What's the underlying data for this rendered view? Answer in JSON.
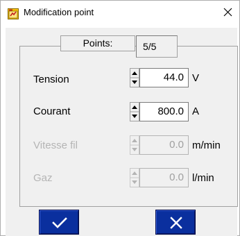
{
  "window": {
    "title": "Modification point",
    "close_glyph": "×"
  },
  "points": {
    "label": "Points:",
    "value": "5/5"
  },
  "params": [
    {
      "label": "Tension",
      "value": "44.0",
      "unit": "V",
      "enabled": true
    },
    {
      "label": "Courant",
      "value": "800.0",
      "unit": "A",
      "enabled": true
    },
    {
      "label": "Vitesse fil",
      "value": "0.0",
      "unit": "m/min",
      "enabled": false
    },
    {
      "label": "Gaz",
      "value": "0.0",
      "unit": "l/min",
      "enabled": false
    }
  ],
  "buttons": {
    "ok_icon": "checkmark-icon",
    "cancel_icon": "close-icon"
  },
  "colors": {
    "button_blue": "#0a2f9e",
    "disabled_text": "#b4b4b4",
    "panel_bg": "#f0f0f0"
  }
}
